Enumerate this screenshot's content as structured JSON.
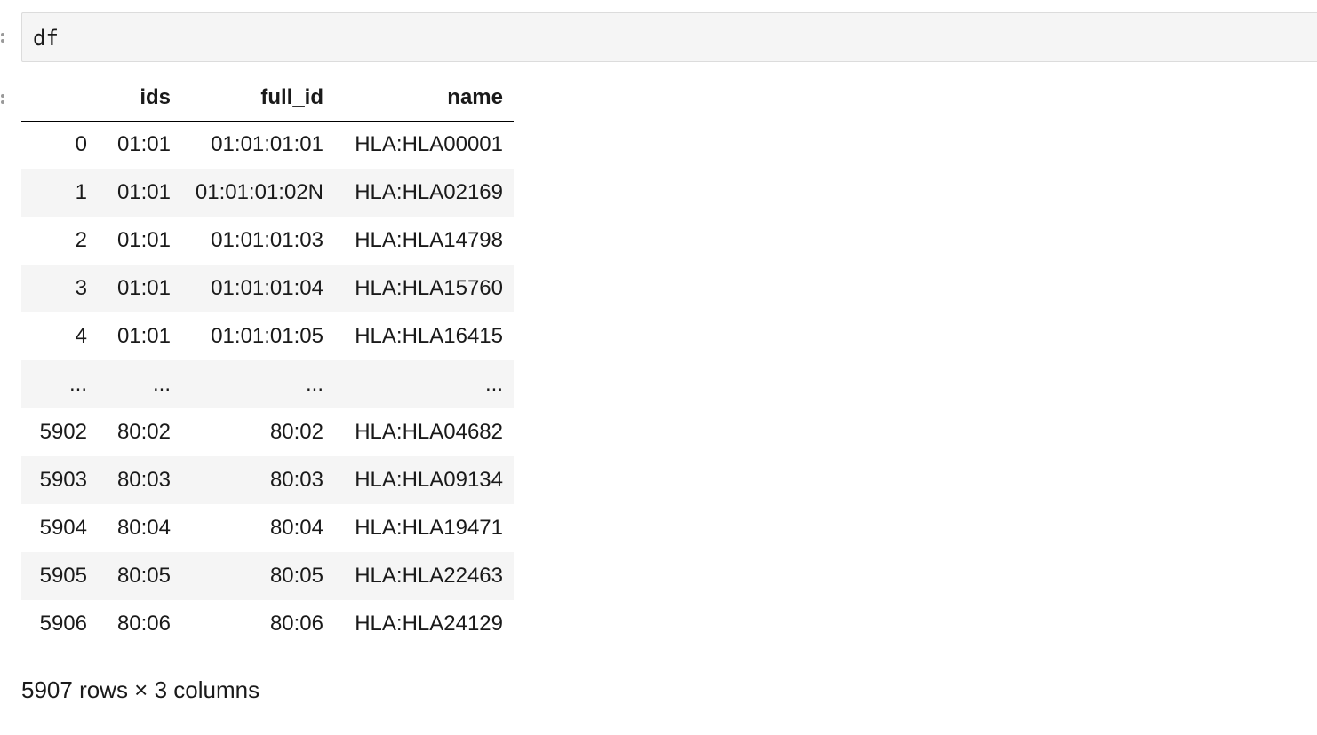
{
  "input_cell": {
    "code": "df"
  },
  "output": {
    "columns": [
      "",
      "ids",
      "full_id",
      "name"
    ],
    "rows": [
      {
        "index": "0",
        "ids": "01:01",
        "full_id": "01:01:01:01",
        "name": "HLA:HLA00001"
      },
      {
        "index": "1",
        "ids": "01:01",
        "full_id": "01:01:01:02N",
        "name": "HLA:HLA02169"
      },
      {
        "index": "2",
        "ids": "01:01",
        "full_id": "01:01:01:03",
        "name": "HLA:HLA14798"
      },
      {
        "index": "3",
        "ids": "01:01",
        "full_id": "01:01:01:04",
        "name": "HLA:HLA15760"
      },
      {
        "index": "4",
        "ids": "01:01",
        "full_id": "01:01:01:05",
        "name": "HLA:HLA16415"
      },
      {
        "index": "...",
        "ids": "...",
        "full_id": "...",
        "name": "..."
      },
      {
        "index": "5902",
        "ids": "80:02",
        "full_id": "80:02",
        "name": "HLA:HLA04682"
      },
      {
        "index": "5903",
        "ids": "80:03",
        "full_id": "80:03",
        "name": "HLA:HLA09134"
      },
      {
        "index": "5904",
        "ids": "80:04",
        "full_id": "80:04",
        "name": "HLA:HLA19471"
      },
      {
        "index": "5905",
        "ids": "80:05",
        "full_id": "80:05",
        "name": "HLA:HLA22463"
      },
      {
        "index": "5906",
        "ids": "80:06",
        "full_id": "80:06",
        "name": "HLA:HLA24129"
      }
    ],
    "shape_text": "5907 rows × 3 columns"
  },
  "colors": {
    "input_background": "#f5f5f5",
    "stripe": "#f5f5f5",
    "border": "#dcdcdc"
  }
}
